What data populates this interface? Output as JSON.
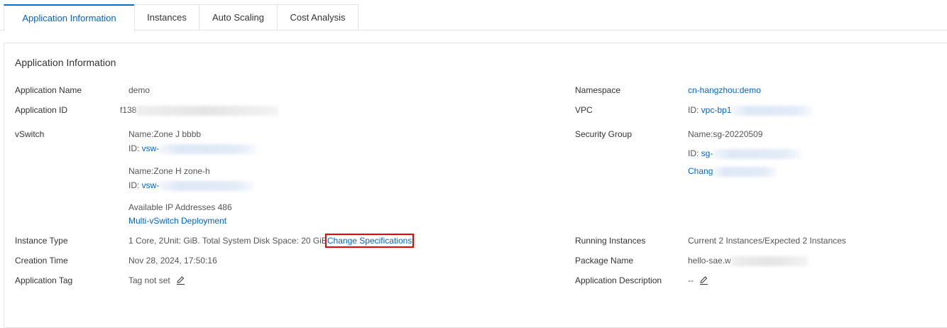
{
  "tabs": [
    "Application Information",
    "Instances",
    "Auto Scaling",
    "Cost Analysis"
  ],
  "section_title": "Application Information",
  "left": {
    "app_name": {
      "label": "Application Name",
      "value": "demo"
    },
    "app_id": {
      "label": "Application ID",
      "value": "f138"
    },
    "vswitch": {
      "label": "vSwitch",
      "zone1_name": "Name:Zone J bbbb",
      "id_prefix": "ID: ",
      "zone1_id": "vsw-",
      "zone2_name": "Name:Zone H zone-h",
      "zone2_id": "vsw-",
      "available_ip": "Available IP Addresses 486",
      "multi_link": "Multi-vSwitch Deployment"
    },
    "instance_type": {
      "label": "Instance Type",
      "value": "1 Core, 2Unit: GiB. Total System Disk Space: 20 GiB",
      "link": "Change Specifications"
    },
    "creation_time": {
      "label": "Creation Time",
      "value": "Nov 28, 2024, 17:50:16"
    },
    "app_tag": {
      "label": "Application Tag",
      "value": "Tag not set"
    }
  },
  "right": {
    "namespace": {
      "label": "Namespace",
      "value": "cn-hangzhou:demo"
    },
    "vpc": {
      "label": "VPC",
      "id_prefix": "ID: ",
      "value": "vpc-bp1"
    },
    "security_group": {
      "label": "Security Group",
      "name": "Name:sg-20220509",
      "id_prefix": "ID: ",
      "id": "sg-",
      "change_link": "Chang"
    },
    "running": {
      "label": "Running Instances",
      "value": "Current 2 Instances/Expected 2 Instances"
    },
    "package": {
      "label": "Package Name",
      "value": "hello-sae.w"
    },
    "description": {
      "label": "Application Description",
      "value": "--"
    }
  }
}
